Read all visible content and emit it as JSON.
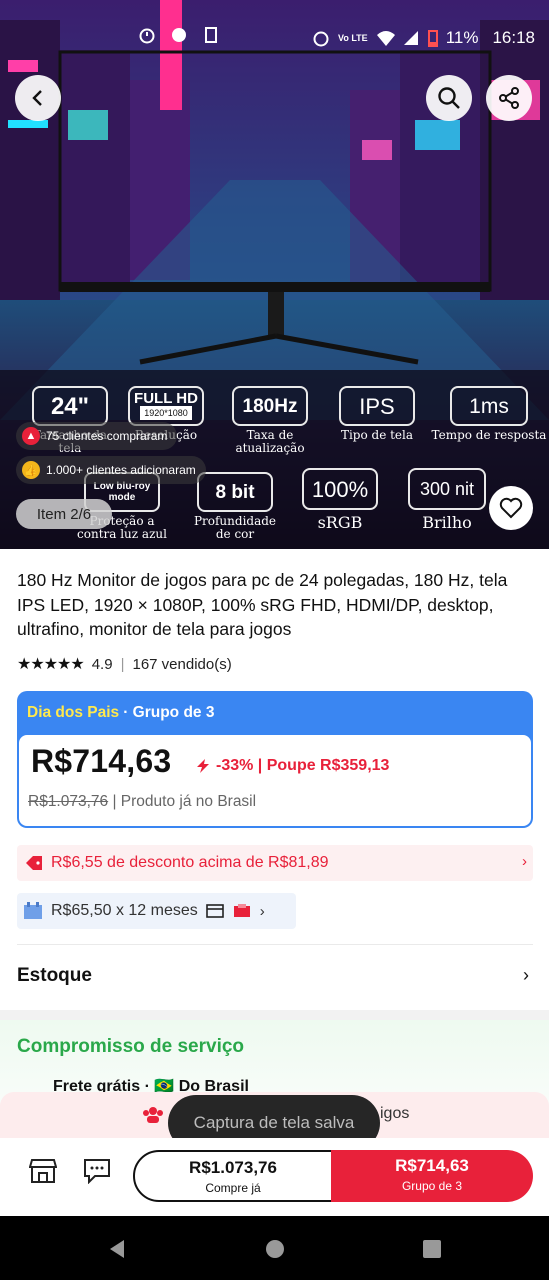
{
  "status_bar": {
    "battery": "11%",
    "time": "16:18",
    "network": "Vo LTE"
  },
  "hero": {
    "back_icon": "chevron-left-icon",
    "search_icon": "search-icon",
    "share_icon": "share-icon",
    "specs_top": [
      {
        "value": "24\"",
        "label": "Tamanho da tela"
      },
      {
        "value": "FULL HD",
        "sub": "1920*1080",
        "label": "Resolução"
      },
      {
        "value": "180Hz",
        "label": "Taxa de atualização"
      },
      {
        "value": "IPS",
        "label": "Tipo de tela"
      },
      {
        "value": "1ms",
        "label": "Tempo de resposta"
      }
    ],
    "specs_bottom": [
      {
        "value": "Low blu-roy mode",
        "label": "Proteção a contra luz azul"
      },
      {
        "value": "8 bit",
        "label": "Profundidade de cor"
      },
      {
        "value": "100%",
        "label": "sRGB"
      },
      {
        "value": "300 nit",
        "label": "Brilho"
      }
    ],
    "buyers_badge": "75 clientes compraram",
    "added_badge": "1.000+ clientes adicionaram",
    "item_indicator": "Item 2/6"
  },
  "product": {
    "title": "180 Hz Monitor de jogos para pc de 24 polegadas, 180 Hz, tela IPS LED, 1920 × 1080P, 100% sRG FHD, HDMI/DP, desktop, ultrafino, monitor de tela para jogos",
    "rating": "4.9",
    "sold": "167 vendido(s)"
  },
  "deal": {
    "event": "Dia dos Pais",
    "group": "· Grupo de 3",
    "price": "R$714,63",
    "discount": "-33% | Poupe R$359,13",
    "old_price": "R$1.073,76",
    "origin": "| Produto já no Brasil"
  },
  "coupon": "R$6,55 de desconto acima de R$81,89",
  "installments": "R$65,50 x 12 meses",
  "stock_label": "Estoque",
  "service": {
    "title": "Compromisso de serviço",
    "frete": "Frete grátis · 🇧🇷 Do Brasil"
  },
  "group_banner": "igos",
  "toast": "Captura de tela salva",
  "bottom_bar": {
    "buy_alone_price": "R$1.073,76",
    "buy_alone_label": "Compre já",
    "buy_group_price": "R$714,63",
    "buy_group_label": "Grupo de 3"
  },
  "colors": {
    "accent_red": "#e8213a",
    "deal_blue": "#3a86f2",
    "service_green": "#2aa84a"
  }
}
